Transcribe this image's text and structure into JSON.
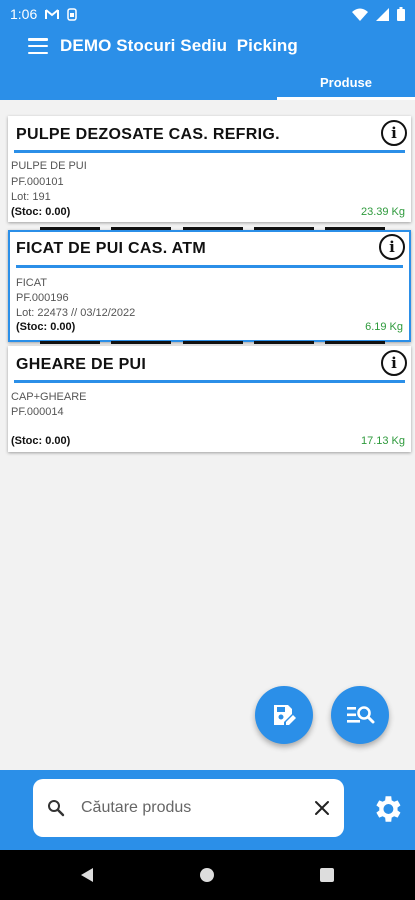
{
  "status_bar": {
    "time": "1:06",
    "icons": [
      "gmail-icon",
      "sim-icon",
      "wifi-icon",
      "signal-icon",
      "battery-icon"
    ]
  },
  "app_bar": {
    "title": "DEMO Stocuri Sediu  Picking"
  },
  "tabs": [
    {
      "label": "Produse",
      "selected": true
    }
  ],
  "products": [
    {
      "name": "PULPE DEZOSATE CAS. REFRIG.",
      "description": "PULPE DE PUI",
      "code": "PF.000101",
      "lot": "Lot: 191",
      "stock": "(Stoc: 0.00)",
      "quantity": "23.39 Kg",
      "selected": false
    },
    {
      "name": "FICAT DE PUI CAS. ATM",
      "description": "FICAT",
      "code": "PF.000196",
      "lot": "Lot: 22473 // 03/12/2022",
      "stock": "(Stoc: 0.00)",
      "quantity": "6.19 Kg",
      "selected": true
    },
    {
      "name": "GHEARE DE PUI",
      "description": "CAP+GHEARE",
      "code": "PF.000014",
      "lot": "",
      "stock": "(Stoc: 0.00)",
      "quantity": "17.13 Kg",
      "selected": false
    }
  ],
  "info_icon_glyph": "i",
  "search": {
    "placeholder": "Căutare produs",
    "value": ""
  },
  "colors": {
    "primary": "#2b8fe8",
    "quantity": "#2e9a3c",
    "nav_background": "#000000"
  }
}
